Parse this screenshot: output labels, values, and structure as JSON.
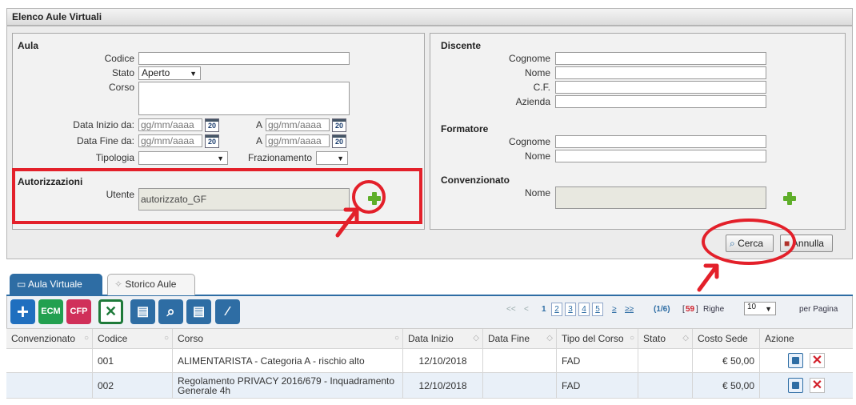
{
  "window": {
    "title": "Elenco Aule Virtuali"
  },
  "aula": {
    "section_title": "Aula",
    "codice_label": "Codice",
    "codice_value": "",
    "stato_label": "Stato",
    "stato_value": "Aperto",
    "corso_label": "Corso",
    "corso_value": "",
    "data_inizio_label": "Data Inizio da:",
    "data_inizio_placeholder": "gg/mm/aaaa",
    "data_fine_label": "Data Fine da:",
    "data_fine_placeholder": "gg/mm/aaaa",
    "a_label": "A",
    "a_placeholder": "gg/mm/aaaa",
    "calendar_text": "20",
    "tipologia_label": "Tipologia",
    "tipologia_value": "",
    "frazionamento_label": "Frazionamento",
    "frazionamento_value": ""
  },
  "autorizzazioni": {
    "section_title": "Autorizzazioni",
    "utente_label": "Utente",
    "utente_value": "autorizzato_GF"
  },
  "discente": {
    "section_title": "Discente",
    "cognome_label": "Cognome",
    "nome_label": "Nome",
    "cf_label": "C.F.",
    "azienda_label": "Azienda"
  },
  "formatore": {
    "section_title": "Formatore",
    "cognome_label": "Cognome",
    "nome_label": "Nome"
  },
  "convenzionato": {
    "section_title": "Convenzionato",
    "nome_label": "Nome"
  },
  "actions": {
    "cerca_label": "Cerca",
    "annulla_label": "Annulla"
  },
  "tabs": [
    {
      "label": "Aula Virtuale",
      "active": true
    },
    {
      "label": "Storico Aule",
      "active": false
    }
  ],
  "toolbar": {
    "ecm_label": "ECM",
    "cfp_label": "CFP",
    "colors": {
      "add": "#1f6fbf",
      "ecm": "#22a050",
      "cfp": "#d0305a",
      "excel": "#1e7a3a",
      "blue": "#2e6da4"
    }
  },
  "pager": {
    "first": "<<",
    "prev": "<",
    "pages": [
      "1",
      "2",
      "3",
      "4",
      "5"
    ],
    "next": "≥",
    "last": "≥≥",
    "page_info": "(1/6)",
    "total": "59",
    "righe_label": "Righe",
    "per_page": "10",
    "per_pagina_label": "per Pagina"
  },
  "table": {
    "headers": [
      "Convenzionato",
      "Codice",
      "Corso",
      "Data Inizio",
      "Data Fine",
      "Tipo del Corso",
      "Stato",
      "Costo Sede",
      "Azione"
    ],
    "rows": [
      {
        "convenzionato": "",
        "codice": "001",
        "corso": "ALIMENTARISTA - Categoria A - rischio alto",
        "data_inizio": "12/10/2018",
        "data_fine": "",
        "tipo": "FAD",
        "stato": "",
        "costo": "€ 50,00"
      },
      {
        "convenzionato": "",
        "codice": "002",
        "corso": "Regolamento PRIVACY 2016/679 - Inquadramento Generale 4h",
        "data_inizio": "12/10/2018",
        "data_fine": "",
        "tipo": "FAD",
        "stato": "",
        "costo": "€ 50,00"
      }
    ]
  },
  "annotation_color": "#e3202a"
}
